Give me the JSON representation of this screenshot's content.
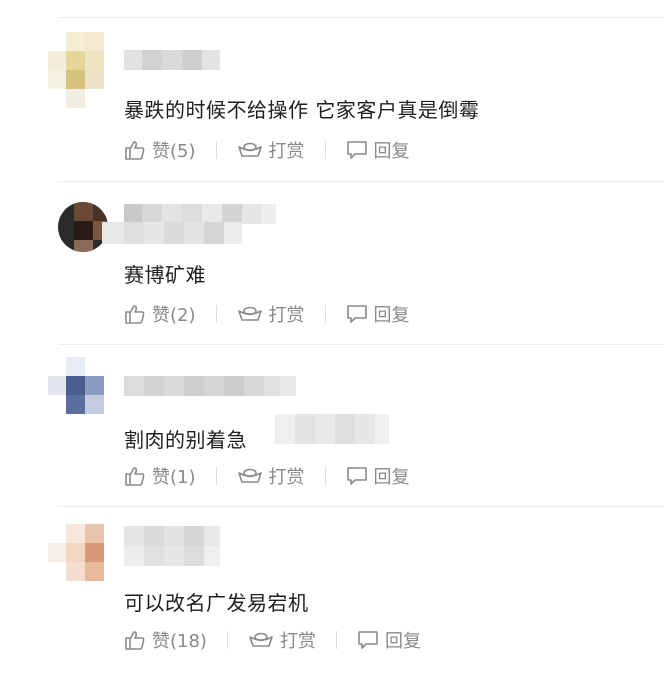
{
  "comments": [
    {
      "text": "暴跌的时候不给操作 它家客户真是倒霉",
      "like_label": "赞(5)",
      "reward_label": "打赏",
      "reply_label": "回复"
    },
    {
      "text": "赛博矿难",
      "like_label": "赞(2)",
      "reward_label": "打赏",
      "reply_label": "回复"
    },
    {
      "text": "割肉的别着急",
      "like_label": "赞(1)",
      "reward_label": "打赏",
      "reply_label": "回复"
    },
    {
      "text": "可以改名广发易宕机",
      "like_label": "赞(18)",
      "reward_label": "打赏",
      "reply_label": "回复"
    }
  ],
  "icons": {
    "like": "thumbs-up-icon",
    "reward": "ingot-icon",
    "reply": "speech-bubble-icon"
  },
  "colors": {
    "action_text": "#8a8a8a",
    "comment_text": "#1f1f1f",
    "divider": "#ececec"
  }
}
